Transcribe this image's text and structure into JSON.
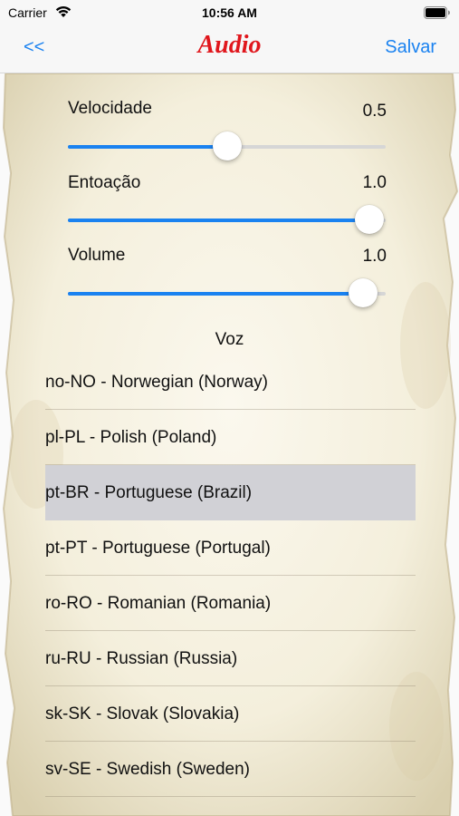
{
  "status_bar": {
    "carrier": "Carrier",
    "time": "10:56 AM"
  },
  "nav": {
    "back_label": "<<",
    "title": "Audio",
    "save_label": "Salvar",
    "title_color": "#e0161c",
    "accent_color": "#1a82f0"
  },
  "sliders": [
    {
      "label": "Velocidade",
      "value_text": "0.5",
      "fraction": 0.5
    },
    {
      "label": "Entoação",
      "value_text": "1.0",
      "fraction": 0.95
    },
    {
      "label": "Volume",
      "value_text": "1.0",
      "fraction": 0.93
    }
  ],
  "voice": {
    "heading": "Voz",
    "selected": "pt-BR - Portuguese (Brazil)",
    "items": [
      "no-NO - Norwegian (Norway)",
      "pl-PL - Polish (Poland)",
      "pt-BR - Portuguese (Brazil)",
      "pt-PT - Portuguese (Portugal)",
      "ro-RO - Romanian (Romania)",
      "ru-RU - Russian (Russia)",
      "sk-SK - Slovak (Slovakia)",
      "sv-SE - Swedish (Sweden)"
    ]
  }
}
